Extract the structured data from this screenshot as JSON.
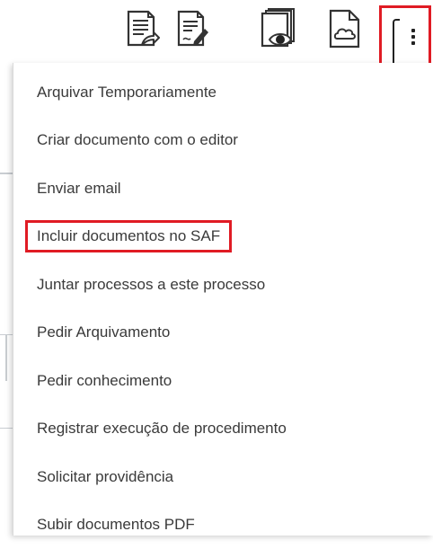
{
  "toolbar": {
    "buttons": [
      {
        "name": "document-share-icon"
      },
      {
        "name": "document-edit-icon"
      },
      {
        "name": "document-view-icon"
      },
      {
        "name": "document-cloud-icon"
      }
    ],
    "more_button": {
      "icon": "more-vertical-icon",
      "highlight_color": "#e01b24"
    }
  },
  "menu": {
    "items": [
      {
        "label": "Arquivar Temporariamente"
      },
      {
        "label": "Criar documento com o editor"
      },
      {
        "label": "Enviar email"
      },
      {
        "label": "Incluir documentos no SAF",
        "highlighted": true
      },
      {
        "label": "Juntar processos a este processo"
      },
      {
        "label": "Pedir Arquivamento"
      },
      {
        "label": "Pedir conhecimento"
      },
      {
        "label": "Registrar execução de procedimento"
      },
      {
        "label": "Solicitar providência"
      },
      {
        "label": "Subir documentos PDF"
      }
    ]
  }
}
